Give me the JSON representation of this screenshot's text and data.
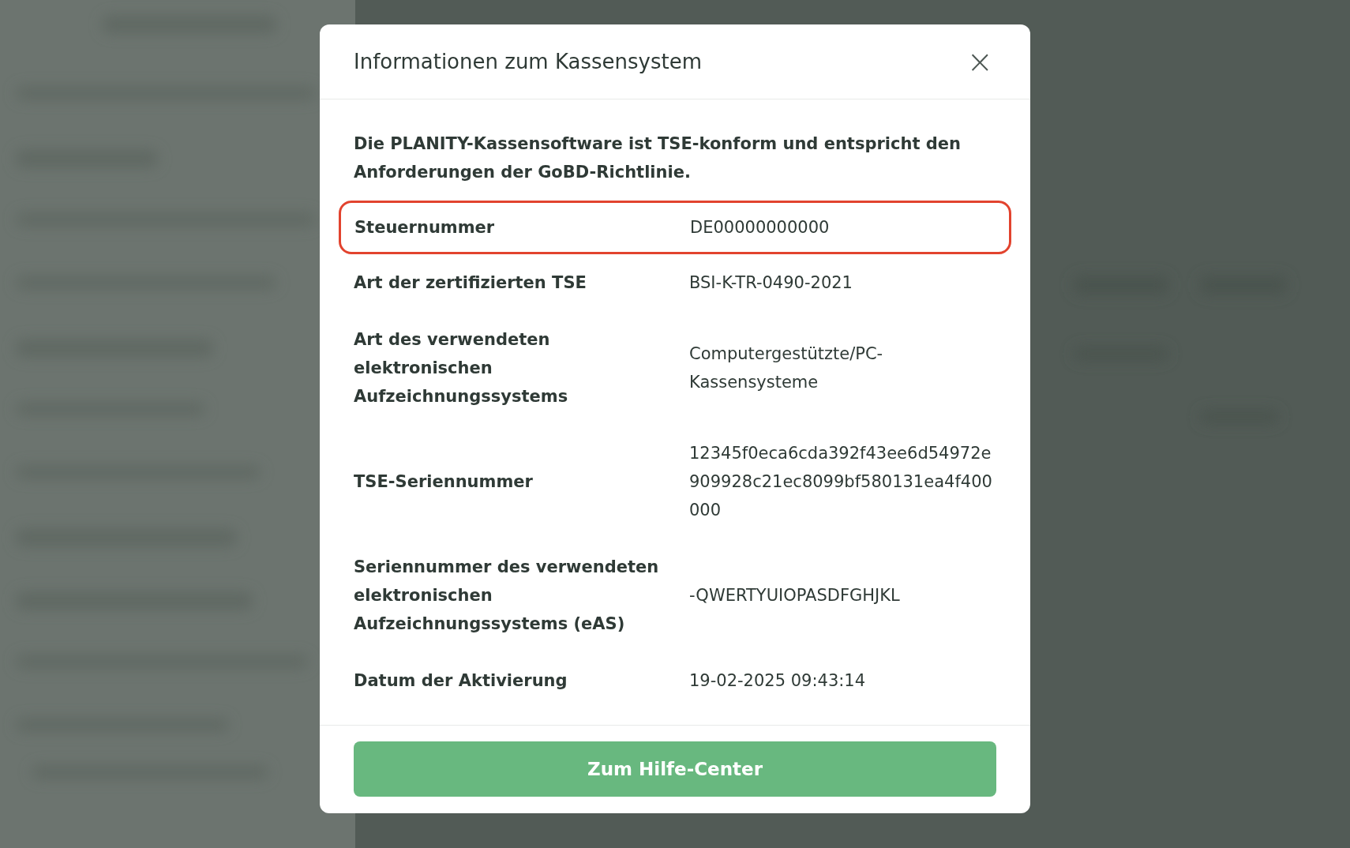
{
  "dialog": {
    "title": "Informationen zum Kassensystem",
    "close_icon": "×",
    "intro": "Die PLANITY-Kassensoftware ist TSE-konform und entspricht den Anforderungen der GoBD-Richtlinie.",
    "rows": [
      {
        "label": "Steuernummer",
        "value": "DE00000000000",
        "highlighted": true
      },
      {
        "label": "Art der zertifizierten TSE",
        "value": "BSI-K-TR-0490-2021",
        "highlighted": false
      },
      {
        "label": "Art des verwendeten elektronischen Aufzeichnungssystems",
        "value": "Computergestützte/PC-Kassensysteme",
        "highlighted": false
      },
      {
        "label": "TSE-Seriennummer",
        "value": "12345f0eca6cda392f43ee6d54972e909928c21ec8099bf580131ea4f400000",
        "highlighted": false
      },
      {
        "label": "Seriennummer des verwendeten elektronischen Aufzeichnungssystems (eAS)",
        "value": "-QWERTYUIOPASDFGHJKL",
        "highlighted": false
      },
      {
        "label": "Datum der Aktivierung",
        "value": "19-02-2025 09:43:14",
        "highlighted": false
      }
    ],
    "button": "Zum Hilfe-Center"
  }
}
